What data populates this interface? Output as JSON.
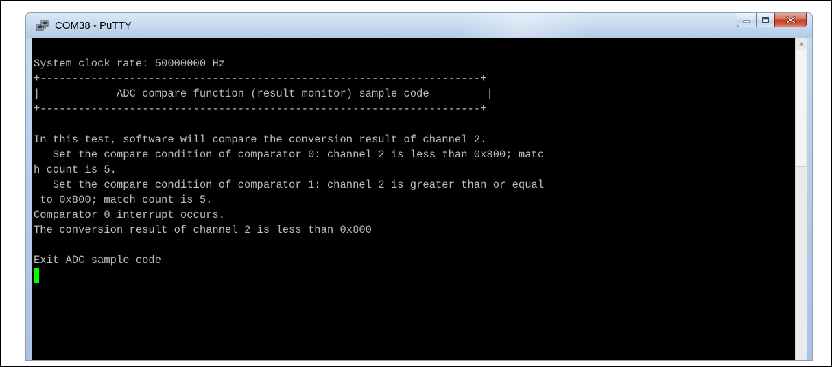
{
  "window": {
    "title": "COM38 - PuTTY",
    "app_icon": "putty-icon",
    "controls": [
      {
        "name": "minimize",
        "icon": "minimize-icon"
      },
      {
        "name": "maximize",
        "icon": "maximize-icon"
      },
      {
        "name": "close",
        "icon": "close-icon"
      }
    ]
  },
  "terminal": {
    "lines": [
      "",
      "System clock rate: 50000000 Hz",
      "+---------------------------------------------------------------------+",
      "|            ADC compare function (result monitor) sample code         |",
      "+---------------------------------------------------------------------+",
      "",
      "In this test, software will compare the conversion result of channel 2.",
      "   Set the compare condition of comparator 0: channel 2 is less than 0x800; matc",
      "h count is 5.",
      "   Set the compare condition of comparator 1: channel 2 is greater than or equal",
      " to 0x800; match count is 5.",
      "Comparator 0 interrupt occurs.",
      "The conversion result of channel 2 is less than 0x800",
      "",
      "Exit ADC sample code"
    ],
    "colors": {
      "background": "#000000",
      "text": "#bbbbbb",
      "cursor": "#00ff00"
    }
  },
  "scrollbar": {
    "up_icon": "scroll-up-arrow-icon"
  }
}
